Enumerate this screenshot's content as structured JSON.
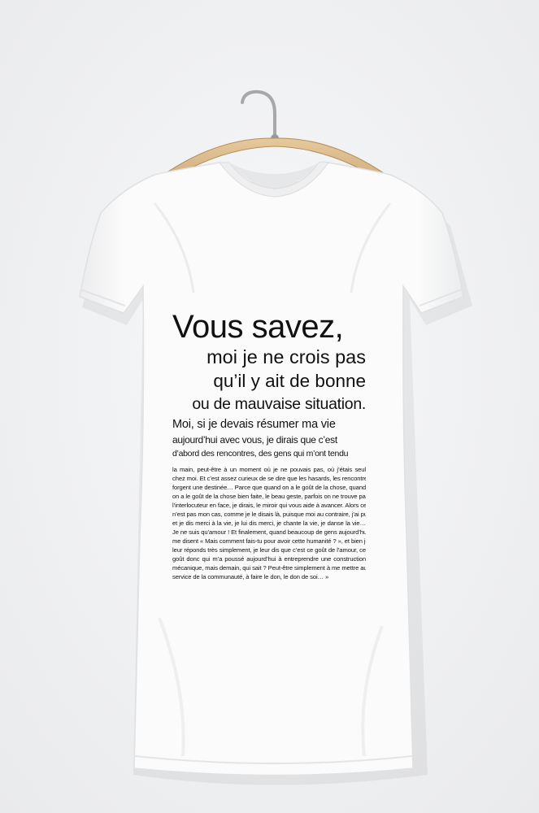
{
  "colors": {
    "background": "#f1f2f3",
    "shirt": "#fbfbfb",
    "shirt_shadow": "#e4e5e7",
    "hanger_wood": "#d8b98c",
    "hanger_hook": "#a8a8a8",
    "print_ink": "#111111"
  },
  "print": {
    "line1": "Vous savez,",
    "line2": "moi je ne crois pas",
    "line3": "qu’il y ait de bonne",
    "line4": "ou de mauvaise situation.",
    "line5": "Moi, si je devais résumer ma vie",
    "line6": "aujourd’hui avec vous, je dirais que c’est",
    "line7": "d’abord des rencontres, des gens qui m’ont tendu",
    "body_lines": [
      "la main, peut-être à un moment où je ne pouvais pas, où j’étais seul",
      "chez moi. Et c’est assez curieux de se dire que les hasards, les rencontres",
      "forgent une destinée… Parce que quand on a le goût de la chose, quand",
      "on a le goût de la chose bien faite, le beau geste, parfois on ne trouve pas",
      "l’interlocuteur en face, je dirais, le miroir qui vous aide à avancer. Alors ce",
      "n’est pas mon cas, comme je le disais là, puisque moi au contraire, j’ai pu:",
      "et je dis merci à la vie, je lui dis merci, je chante la vie, je danse la vie…",
      "Je ne suis qu’amour ! Et finalement, quand beaucoup de gens aujourd’hui",
      "me disent « Mais comment fais-tu pour avoir cette humanité ? », et bien je",
      "leur réponds très simplement, je leur dis que c’est ce goût de l’amour, ce",
      "goût donc qui m’a poussé aujourd’hui à entreprendre une construction",
      "mécanique, mais demain, qui sait ? Peut-être simplement à me mettre au",
      "service de la communauté, à faire le don, le don de soi… »"
    ]
  }
}
